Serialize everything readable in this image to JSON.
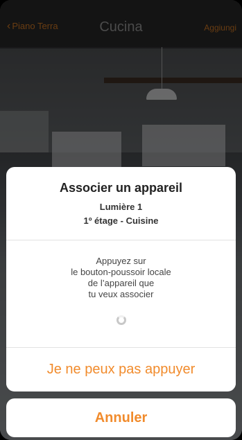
{
  "navbar": {
    "back_label": "Piano Terra",
    "title": "Cucina",
    "add_label": "Aggiungi"
  },
  "sheet": {
    "title": "Associer un appareil",
    "device": "Lumière 1",
    "location": "1º étage - Cuisine",
    "instructions": [
      "Appuyez sur",
      "le bouton-poussoir locale",
      "de l’appareil que",
      "tu veux associer"
    ],
    "cant_press_label": "Je ne peux pas appuyer"
  },
  "cancel_label": "Annuler",
  "colors": {
    "accent": "#f18b2c",
    "sheet_bg": "#ffffff"
  },
  "icons": {
    "back": "chevron-left-icon",
    "spinner": "loading-spinner-icon"
  }
}
